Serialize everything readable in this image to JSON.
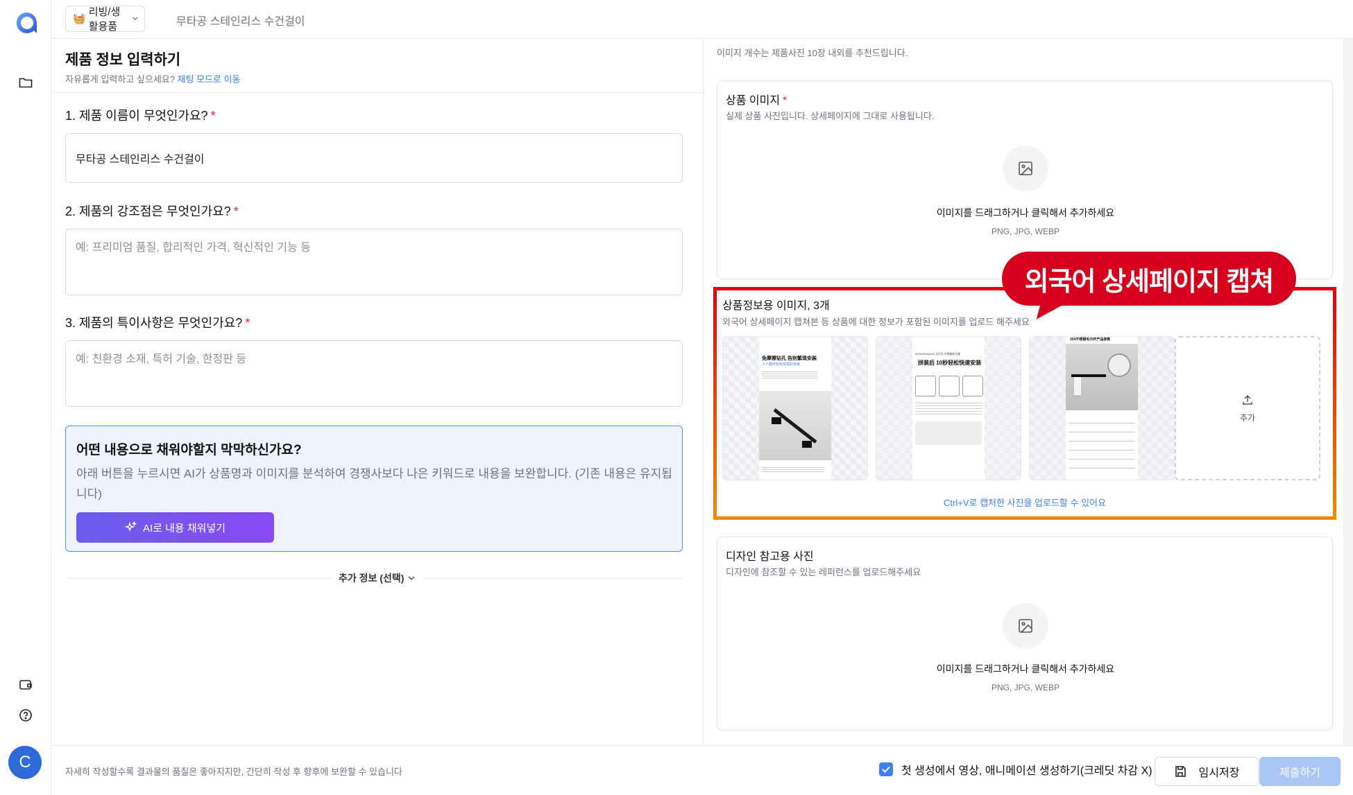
{
  "app": {
    "sidebar": {
      "logo_icon": "app-logo-icon",
      "items": [
        {
          "icon": "folder-icon"
        },
        {
          "icon": "wallet-icon"
        },
        {
          "icon": "help-circle-icon"
        }
      ],
      "avatar_initial": "C"
    }
  },
  "topbar": {
    "category_emoji": "🧺",
    "category_label": "리빙/생활용품",
    "product_name": "무타공 스테인리스 수건걸이"
  },
  "form": {
    "title": "제품 정보 입력하기",
    "subtitle": "자유롭게 입력하고 싶으세요?",
    "chat_link": "채팅 모드로 이동",
    "questions": [
      {
        "label": "1. 제품 이름이 무엇인가요?",
        "required": "*",
        "value": "무타공 스테인리스 수건걸이",
        "placeholder": ""
      },
      {
        "label": "2. 제품의 강조점은 무엇인가요?",
        "required": "*",
        "value": "",
        "placeholder": "예: 프리미엄 품질, 합리적인 가격, 혁신적인 기능 등"
      },
      {
        "label": "3. 제품의 특이사항은 무엇인가요?",
        "required": "*",
        "value": "",
        "placeholder": "예: 친환경 소재, 특허 기술, 한정판 등"
      }
    ],
    "ai_box": {
      "title": "어떤 내용으로 채워야할지 막막하신가요?",
      "description": "아래 버튼을 누르시면 AI가 상품명과 이미지를 분석하여 경쟁사보다 나은 키워드로 내용을 보완합니다. (기존 내용은 유지됩니다)",
      "button_label": "AI로 내용 채워넣기"
    },
    "more_info_label": "추가 정보 (선택)"
  },
  "images": {
    "note": "이미지 개수는 제품사진 10장 내외를 추천드립니다.",
    "product": {
      "title": "상품 이미지",
      "required": "*",
      "subtitle": "실제 상품 사진입니다. 상세페이지에 그대로 사용됩니다.",
      "drop_text": "이미지를 드래그하거나 클릭해서 추가하세요",
      "formats": "PNG, JPG, WEBP"
    },
    "info": {
      "title": "상품정보용 이미지, 3개",
      "subtitle": "외국어 상세페이지 캡쳐본 등 상품에 대한 정보가 포함된 이미지를 업로드 해주세요",
      "thumbnails": [
        {
          "heading": "免摩擦钻孔 告别繁琐安装",
          "sub": "人人都可轻松完成的安装"
        },
        {
          "heading": "拼装后 10秒轻松快速安装",
          "sub": "MODERN•DUO 无钉孔不锈钢毛巾架"
        },
        {
          "heading": "304不锈钢毛巾杆产品参数",
          "sub": ""
        }
      ],
      "add_label": "추가",
      "paste_hint": "Ctrl+V로 캡처한 사진을 업로드할 수 있어요",
      "callout": "외국어 상세페이지 캡쳐",
      "highlight_color": "#e60012"
    },
    "design": {
      "title": "디자인 참고용 사진",
      "subtitle": "디자인에 참조할 수 있는 레퍼런스를 업로드해주세요",
      "drop_text": "이미지를 드래그하거나 클릭해서 추가하세요",
      "formats": "PNG, JPG, WEBP"
    }
  },
  "footer": {
    "note": "자세히 작성할수록 결과물의 품질은 좋아지지만, 간단히 작성 후 향후에 보완할 수 있습니다",
    "checkbox_label": "첫 생성에서 영상, 애니메이션 생성하기(크레딧 차감 X)",
    "checkbox_checked": true,
    "save_label": "임시저장",
    "submit_label": "제출하기"
  },
  "colors": {
    "accent": "#3b82f6",
    "ai_gradient_start": "#6a5cf0",
    "ai_gradient_end": "#8a4af2",
    "callout": "#d6001c"
  }
}
